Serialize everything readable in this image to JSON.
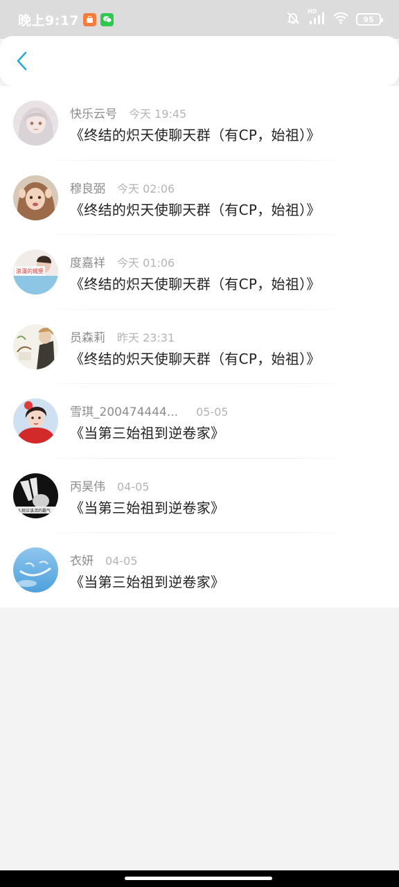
{
  "status_bar": {
    "time": "晚上9:17",
    "battery": "95",
    "hd_label": "HD"
  },
  "header": {
    "back_icon": "chevron-left-icon",
    "accent_color": "#2aa6e0"
  },
  "rows": [
    {
      "name": "快乐云号",
      "time": "今天 19:45",
      "message": "《终结的炽天使聊天群（有CP，始祖）》"
    },
    {
      "name": "穆良弼",
      "time": "今天 02:06",
      "message": "《终结的炽天使聊天群（有CP，始祖）》"
    },
    {
      "name": "度嘉祥",
      "time": "今天 01:06",
      "message": "《终结的炽天使聊天群（有CP，始祖）》",
      "avatar_text": "浪漫的城堡"
    },
    {
      "name": "员森莉",
      "time": "昨天 23:31",
      "message": "《终结的炽天使聊天群（有CP，始祖）》"
    },
    {
      "name": "雪琪_200474444...",
      "time": "05-05",
      "message": "《当第三始祖到逆卷家》"
    },
    {
      "name": "丙昊伟",
      "time": "04-05",
      "message": "《当第三始祖到逆卷家》",
      "avatar_text": "人就应该活的霸气"
    },
    {
      "name": "衣妍",
      "time": "04-05",
      "message": "《当第三始祖到逆卷家》"
    }
  ]
}
